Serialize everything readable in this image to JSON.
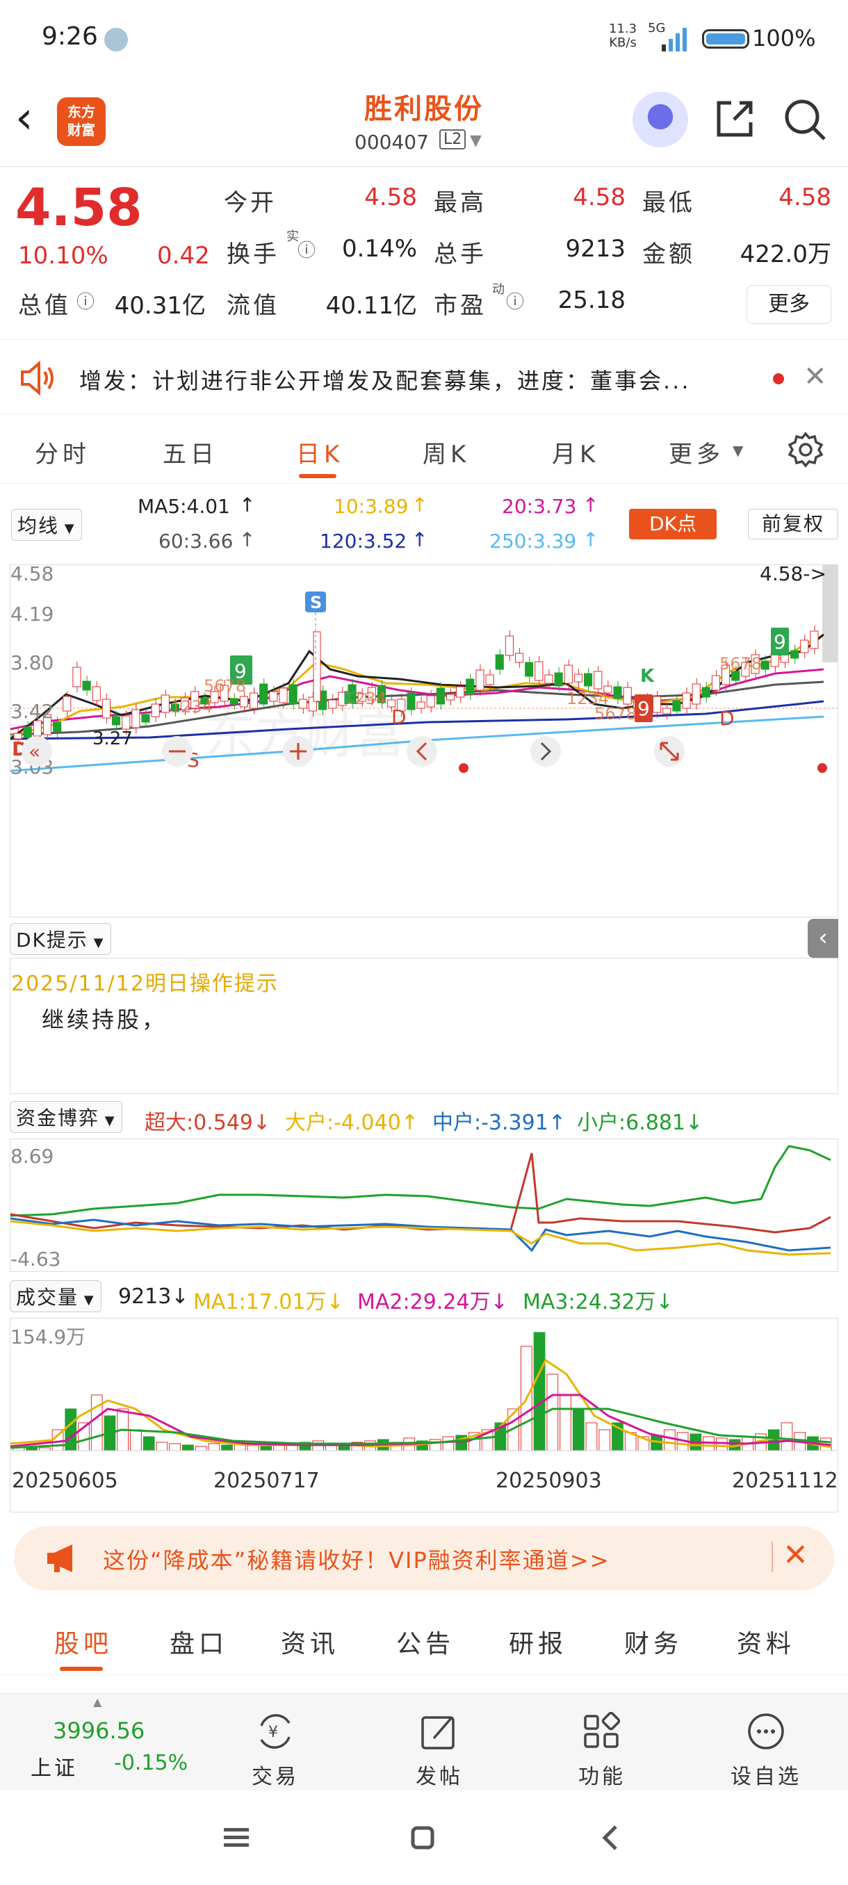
{
  "status_bar": {
    "time": "9:26",
    "net_speed": "11.3",
    "net_unit": "KB/s",
    "signal": "5G",
    "battery": "100%"
  },
  "header": {
    "logo_line1": "东方",
    "logo_line2": "财富",
    "stock_name": "胜利股份",
    "stock_code": "000407",
    "level": "L2"
  },
  "quote": {
    "price": "4.58",
    "change_pct": "10.10%",
    "change": "0.42",
    "fields": [
      {
        "label": "今开",
        "value": "4.58"
      },
      {
        "label": "最高",
        "value": "4.58"
      },
      {
        "label": "最低",
        "value": "4.58"
      },
      {
        "label": "换手",
        "value": "0.14%"
      },
      {
        "label": "总手",
        "value": "9213"
      },
      {
        "label": "金额",
        "value": "422.0万"
      },
      {
        "label": "总值",
        "value": "40.31亿"
      },
      {
        "label": "流值",
        "value": "40.11亿"
      },
      {
        "label": "市盈",
        "value": "25.18"
      }
    ],
    "turnover_sup": "实",
    "pe_sup": "动",
    "more": "更多"
  },
  "notice": {
    "text": "增发：计划进行非公开增发及配套募集，进度：董事会..."
  },
  "period_tabs": [
    "分时",
    "五日",
    "日K",
    "周K",
    "月K",
    "更多"
  ],
  "ma_row": {
    "selector": "均线",
    "ma5": "MA5:4.01",
    "ma10": "10:3.89",
    "ma20": "20:3.73",
    "ma60": "60:3.66",
    "ma120": "120:3.52",
    "ma250": "250:3.39",
    "dk_button": "DK点",
    "fq_button": "前复权"
  },
  "kchart": {
    "y_labels": [
      "4.58",
      "4.19",
      "3.80",
      "3.42",
      "3.03"
    ],
    "last_price_tag": "4.58->",
    "low_tag": "3.27",
    "signals": [
      "S",
      "9",
      "9",
      "9",
      "K",
      "K",
      "D",
      "D",
      "S",
      "D"
    ],
    "seq_labels": [
      "1234",
      "5678",
      "1234",
      "5678",
      "1234",
      "5678"
    ],
    "watermark": "东方财富",
    "colors": {
      "up": "#e02c2c",
      "down": "#1fa12d",
      "ma5": "#222222",
      "ma10": "#e8b400",
      "ma20": "#d4159b",
      "ma60": "#555555",
      "ma120": "#1b2ea8",
      "ma250": "#58b8f0"
    }
  },
  "dk_tip": {
    "selector": "DK提示",
    "date": "2025/11/12明日操作提示",
    "advice": "继续持股，"
  },
  "fund_flow": {
    "selector": "资金博弈",
    "super_large": "超大:0.549",
    "large": "大户:-4.040",
    "medium": "中户:-3.391",
    "small": "小户:6.881",
    "y_top": "8.69",
    "y_bottom": "-4.63"
  },
  "volume": {
    "selector": "成交量",
    "current": "9213",
    "ma1": "MA1:17.01万",
    "ma2": "MA2:29.24万",
    "ma3": "MA3:24.32万",
    "y_top": "154.9万",
    "dates": [
      "20250605",
      "20250717",
      "20250903",
      "20251112"
    ]
  },
  "ad": {
    "text": "这份“降成本”秘籍请收好！VIP融资利率通道>>"
  },
  "sub_tabs": [
    "股吧",
    "盘口",
    "资讯",
    "公告",
    "研报",
    "财务",
    "资料"
  ],
  "bottom_nav": {
    "index_value": "3996.56",
    "index_name": "上证",
    "index_change": "-0.15%",
    "items": [
      "交易",
      "发帖",
      "功能",
      "设自选"
    ]
  }
}
